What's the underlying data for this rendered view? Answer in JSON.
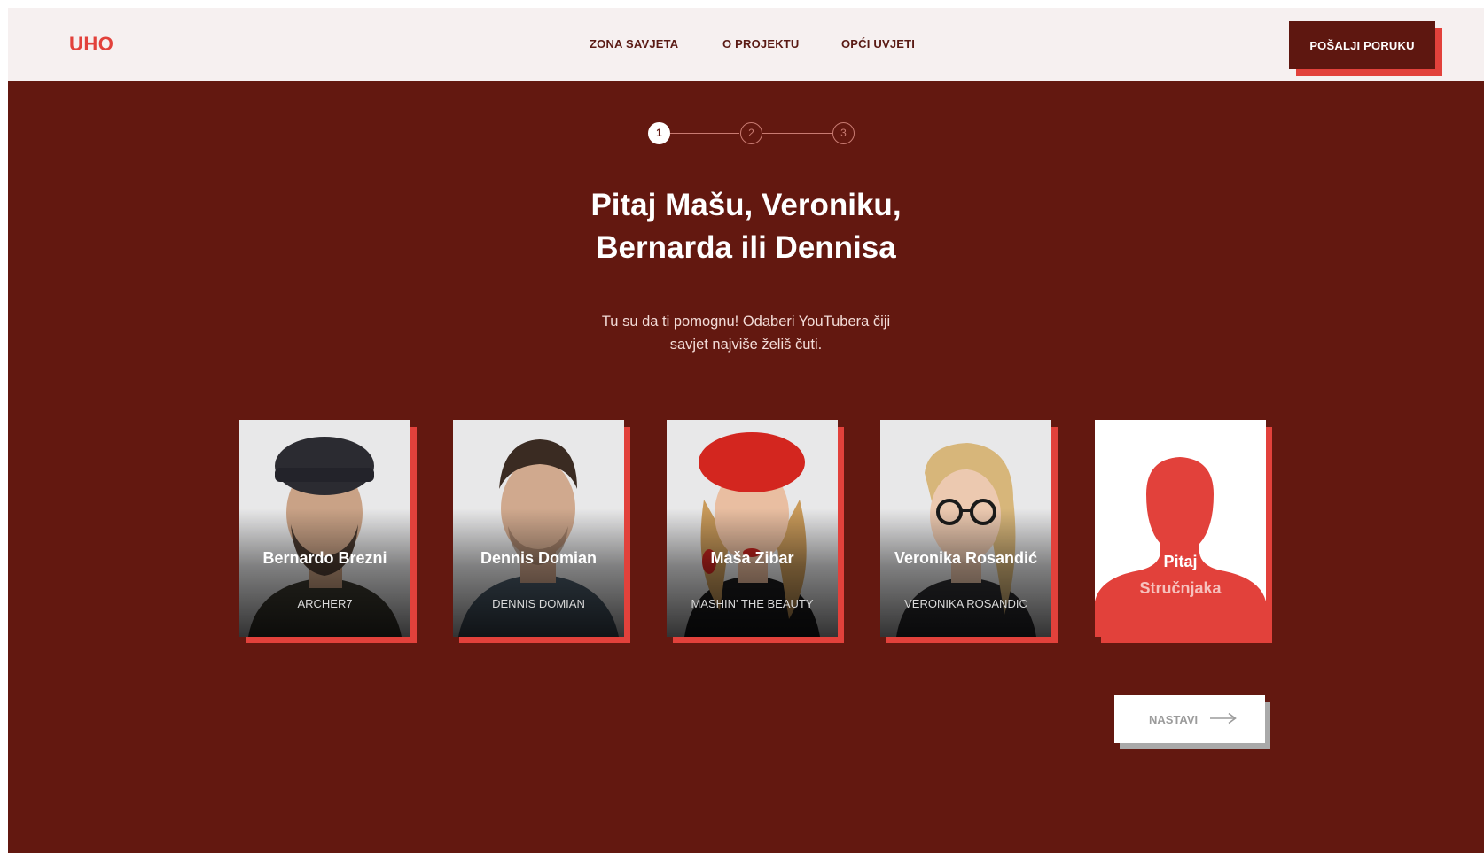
{
  "header": {
    "logo": "UHO",
    "nav": [
      "ZONA SAVJETA",
      "O PROJEKTU",
      "OPĆI UVJETI"
    ],
    "cta": "POŠALJI PORUKU"
  },
  "stepper": {
    "steps": [
      "1",
      "2",
      "3"
    ],
    "current": 1
  },
  "hero": {
    "title": "Pitaj Mašu, Veroniku, Bernarda ili Dennisa",
    "subtitle": "Tu su da ti pomognu! Odaberi YouTubera čiji savjet najviše želiš čuti."
  },
  "cards": [
    {
      "name": "Bernardo Brezni",
      "channel": "ARCHER7"
    },
    {
      "name": "Dennis Domian",
      "channel": "DENNIS DOMIAN"
    },
    {
      "name": "Maša Zibar",
      "channel": "MASHIN' THE BEAUTY"
    },
    {
      "name": "Veronika Rosandić",
      "channel": "VERONIKA ROSANDIC"
    }
  ],
  "expert_card": {
    "line1": "Pitaj",
    "line2": "Stručnjaka"
  },
  "next_button": "NASTAVI",
  "colors": {
    "primary_dark": "#631810",
    "accent": "#e2413b",
    "header_bg": "#f6f0f0"
  }
}
